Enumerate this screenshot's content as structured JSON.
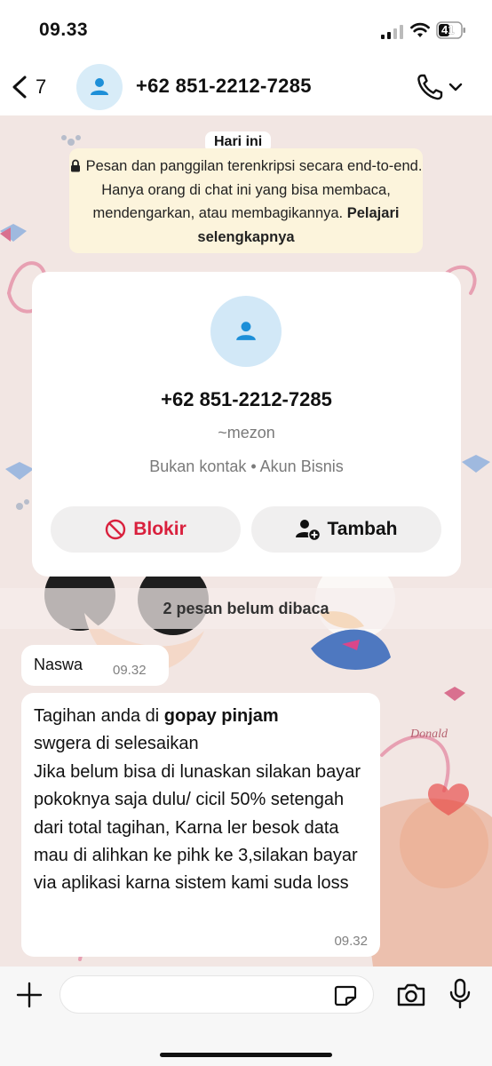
{
  "status_bar": {
    "time": "09.33",
    "battery": "41"
  },
  "header": {
    "back_count": "7",
    "title": "+62 851-2212-7285"
  },
  "chat": {
    "date_label": "Hari ini",
    "encryption_notice": "Pesan dan panggilan terenkripsi secara end-to-end. Hanya orang di chat ini yang bisa membaca, mendengarkan, atau membagikannya.",
    "encryption_link": "Pelajari selengkapnya",
    "unread_banner": "2 pesan belum dibaca"
  },
  "contact_card": {
    "phone": "+62 851-2212-7285",
    "alias": "~mezon",
    "meta": "Bukan kontak • Akun Bisnis",
    "block_label": "Blokir",
    "add_label": "Tambah"
  },
  "messages": [
    {
      "sender": "Naswa",
      "time": "09.32"
    },
    {
      "text_prefix": "Tagihan anda di ",
      "text_bold": "gopay pinjam",
      "text_rest": "swgera di selesaikan\nJika belum bisa di lunaskan silakan bayar pokoknya saja dulu/ cicil 50% setengah dari total tagihan, Karna ler besok data mau di alihkan ke pihk ke 3,silakan bayar via aplikasi karna sistem kami suda loss",
      "time": "09.32"
    }
  ],
  "colors": {
    "block_red": "#d9203d",
    "notice_bg": "#fcf4dc",
    "avatar_blue": "#1d8fd8"
  },
  "icons": [
    "back-chevron-icon",
    "user-icon",
    "phone-icon",
    "chevron-down-icon",
    "lock-icon",
    "block-icon",
    "add-user-icon",
    "plus-icon",
    "sticker-icon",
    "camera-icon",
    "mic-icon"
  ]
}
